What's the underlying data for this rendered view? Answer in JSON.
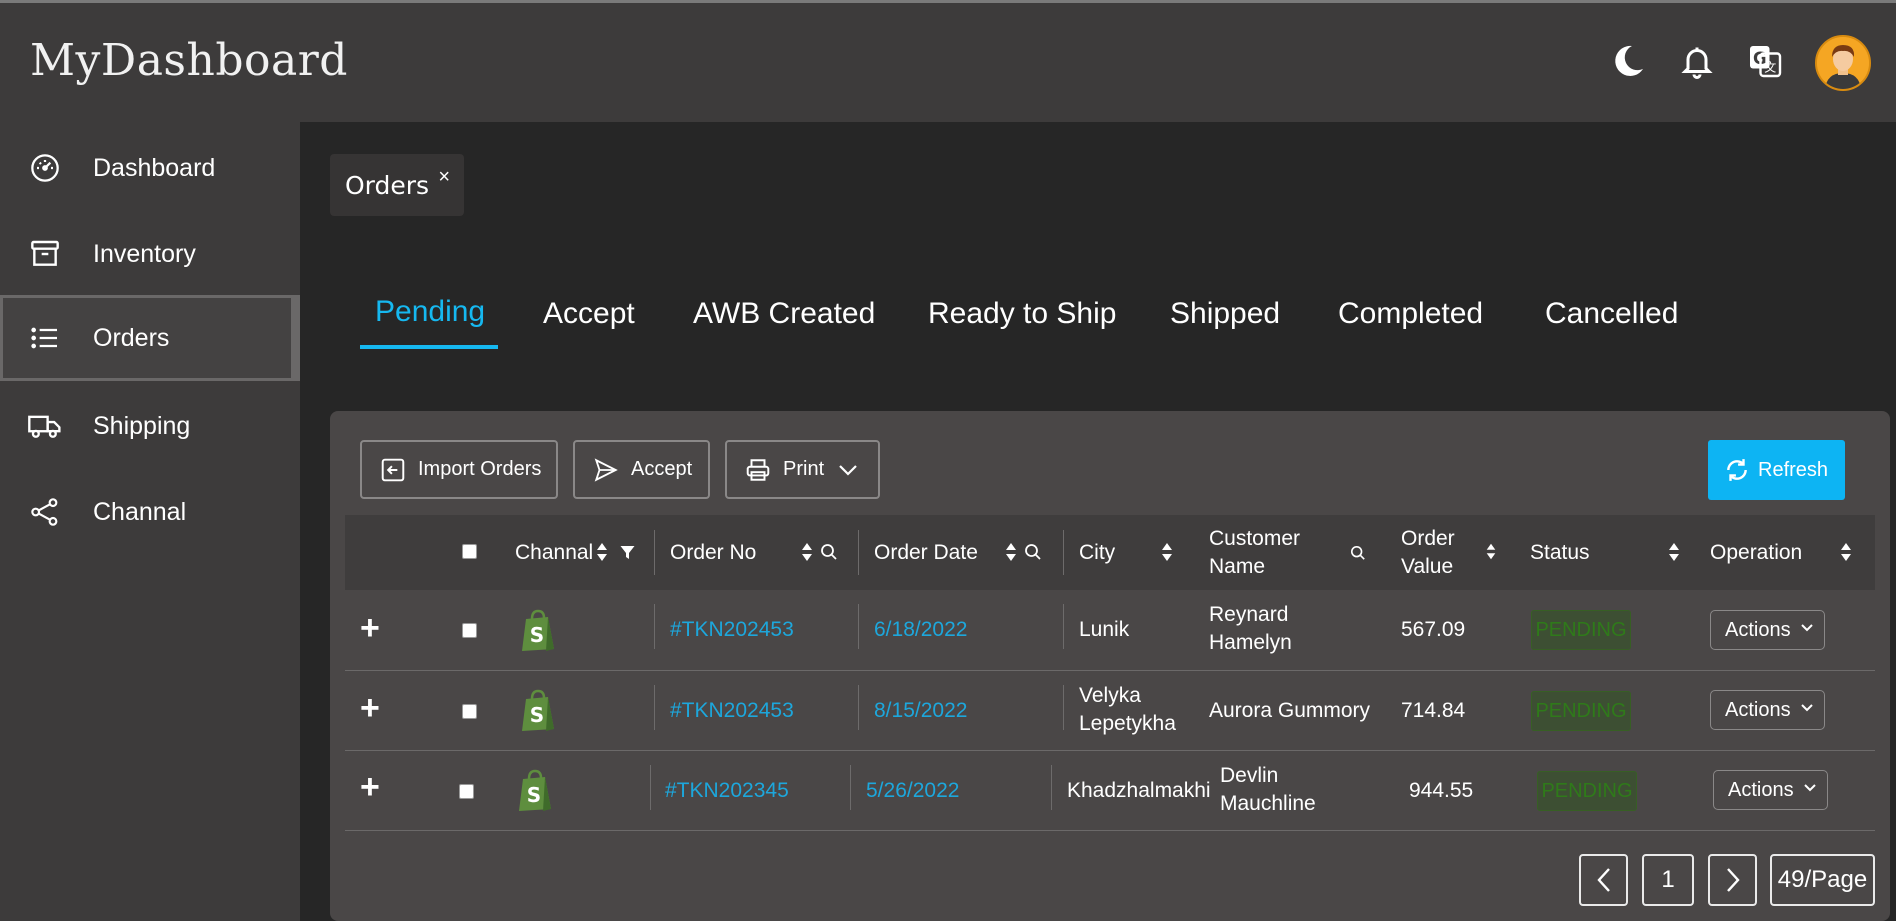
{
  "app": {
    "title": "MyDashboard"
  },
  "header_icons": [
    "moon-icon",
    "bell-icon",
    "translate-icon",
    "avatar"
  ],
  "sidebar": {
    "items": [
      {
        "label": "Dashboard",
        "icon": "speedometer-icon"
      },
      {
        "label": "Inventory",
        "icon": "archive-box-icon"
      },
      {
        "label": "Orders",
        "icon": "list-icon",
        "active": true
      },
      {
        "label": "Shipping",
        "icon": "truck-icon"
      },
      {
        "label": "Channal",
        "icon": "share-icon"
      }
    ]
  },
  "page_tab": {
    "label": "Orders",
    "close": "×"
  },
  "status_tabs": [
    "Pending",
    "Accept",
    "AWB Created",
    "Ready to Ship",
    "Shipped",
    "Completed",
    "Cancelled"
  ],
  "active_status_tab": "Pending",
  "toolbar": {
    "import_label": "Import Orders",
    "accept_label": "Accept",
    "print_label": "Print",
    "refresh_label": "Refresh"
  },
  "table": {
    "columns": {
      "channal": "Channal",
      "order_no": "Order No",
      "order_date": "Order Date",
      "city": "City",
      "customer_line1": "Customer",
      "customer_line2": "Name",
      "value_line1": "Order",
      "value_line2": "Value",
      "status": "Status",
      "operation": "Operation"
    },
    "rows": [
      {
        "expand": "+",
        "channel_icon": "shopify-icon",
        "order_no": "#TKN202453",
        "order_date": "6/18/2022",
        "city_1": "Lunik",
        "city_2": "",
        "customer_1": "Reynard",
        "customer_2": "Hamelyn",
        "value": "567.09",
        "status": "PENDING",
        "action": "Actions"
      },
      {
        "expand": "+",
        "channel_icon": "shopify-icon",
        "order_no": "#TKN202453",
        "order_date": "8/15/2022",
        "city_1": "Velyka",
        "city_2": "Lepetykha",
        "customer_1": "Aurora Gummory",
        "customer_2": "",
        "value": "714.84",
        "status": "PENDING",
        "action": "Actions"
      },
      {
        "expand": "+",
        "channel_icon": "shopify-icon",
        "order_no": "#TKN202345",
        "order_date": "5/26/2022",
        "city_1": "Khadzhalmakhi",
        "city_2": "",
        "customer_1": "Devlin",
        "customer_2": "Mauchline",
        "value": "944.55",
        "status": "PENDING",
        "action": "Actions"
      }
    ]
  },
  "pagination": {
    "page": "1",
    "page_size": "49/Page"
  },
  "colors": {
    "accent": "#16b8f0",
    "refresh_bg": "#0db4f3",
    "link": "#1da7dc",
    "pending_text": "#2f7a1a"
  }
}
